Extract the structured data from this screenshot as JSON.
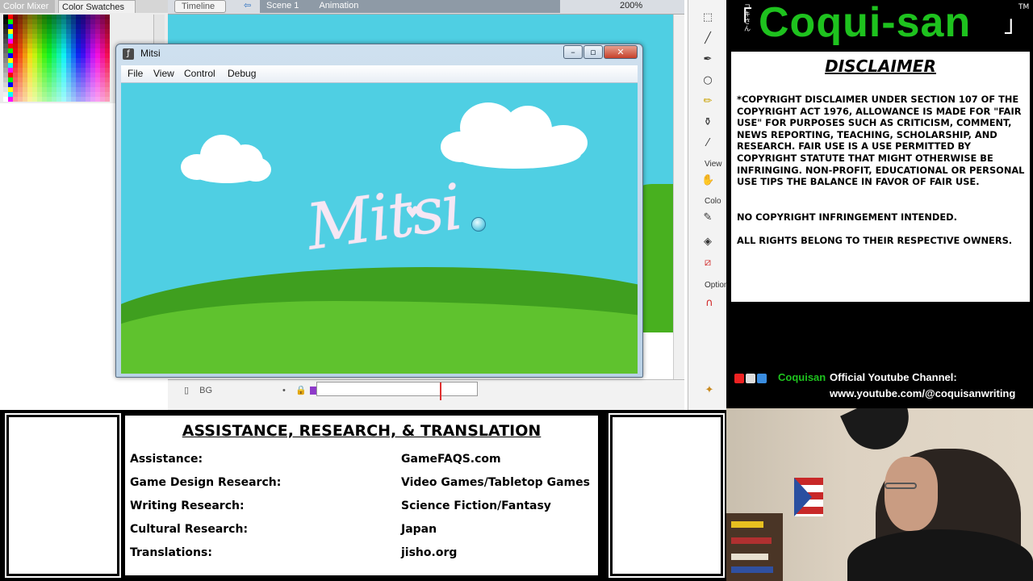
{
  "ide": {
    "panel_tabs": [
      "Color Mixer",
      "Color Swatches"
    ],
    "timeline_tab": "Timeline",
    "scene_label": "Scene 1",
    "symbol_label": "Animation",
    "zoom": "200%",
    "layer_name": "BG",
    "tool_labels": [
      "View",
      "Colo",
      "Option"
    ]
  },
  "player": {
    "title": "Mitsi",
    "menu": [
      "File",
      "View",
      "Control",
      "Debug"
    ],
    "logo_text": "Mitsi"
  },
  "brand": {
    "name": "Coqui-san",
    "jp": "コキさん",
    "tm": "TM"
  },
  "disclaimer": {
    "title": "DISCLAIMER",
    "body": "*COPYRIGHT DISCLAIMER UNDER SECTION 107 OF THE COPYRIGHT ACT 1976, ALLOWANCE IS MADE FOR \"FAIR USE\" FOR PURPOSES SUCH AS CRITICISM, COMMENT, NEWS REPORTING, TEACHING, SCHOLARSHIP, AND RESEARCH. FAIR USE IS A USE PERMITTED BY COPYRIGHT STATUTE THAT MIGHT OTHERWISE BE INFRINGING. NON-PROFIT, EDUCATIONAL OR PERSONAL USE TIPS THE BALANCE IN FAVOR OF FAIR USE.",
    "line2": "NO COPYRIGHT INFRINGEMENT INTENDED.",
    "line3": "ALL RIGHTS BELONG TO THEIR RESPECTIVE OWNERS."
  },
  "youtube": {
    "handle": "Coquisan",
    "label": "Official Youtube Channel:",
    "url": "www.youtube.com/@coquisanwriting"
  },
  "credits": {
    "title": "ASSISTANCE, RESEARCH, & TRANSLATION",
    "rows": [
      {
        "key": "Assistance:",
        "value": "GameFAQS.com"
      },
      {
        "key": "Game Design Research:",
        "value": "Video Games/Tabletop Games"
      },
      {
        "key": "Writing Research:",
        "value": "Science Fiction/Fantasy"
      },
      {
        "key": "Cultural Research:",
        "value": "Japan"
      },
      {
        "key": "Translations:",
        "value": "jisho.org"
      }
    ]
  },
  "colors": {
    "brand_green": "#1ec21e",
    "sky": "#4fcfe3",
    "hill_dark": "#3f9f1f",
    "hill_light": "#5fc22e"
  }
}
